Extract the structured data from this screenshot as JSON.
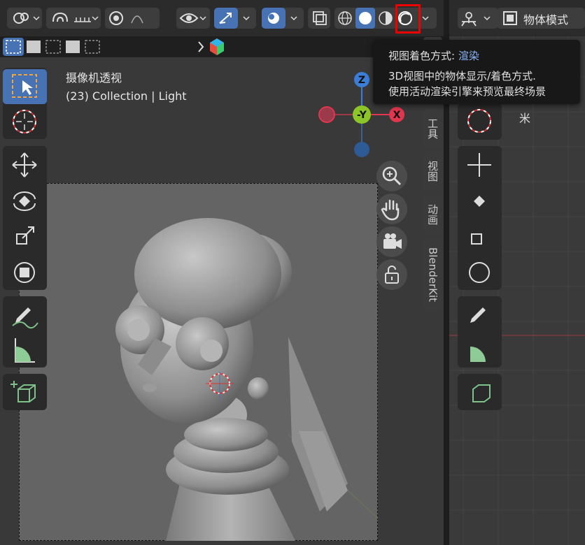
{
  "viewport": {
    "title": "摄像机透视",
    "collection_info": "(23) Collection | Light"
  },
  "side_tabs": [
    "工具",
    "视图",
    "动画",
    "BlenderKit"
  ],
  "right_panel": {
    "mode_label": "物体模式",
    "partial_text": "米"
  },
  "tooltip": {
    "title_prefix": "视图着色方式: ",
    "title_value": "渲染",
    "desc_line1": "3D视图中的物体显示/着色方式.",
    "desc_line2": "使用活动渲染引擎来预览最终场景"
  },
  "gizmo": {
    "z_label": "Z",
    "y_label": "-Y",
    "x_label": "X"
  },
  "colors": {
    "accent": "#4772b3",
    "x_axis": "#e0364e",
    "y_axis": "#8cc52a",
    "z_axis": "#3a7ed8",
    "highlight": "#ee0000"
  }
}
